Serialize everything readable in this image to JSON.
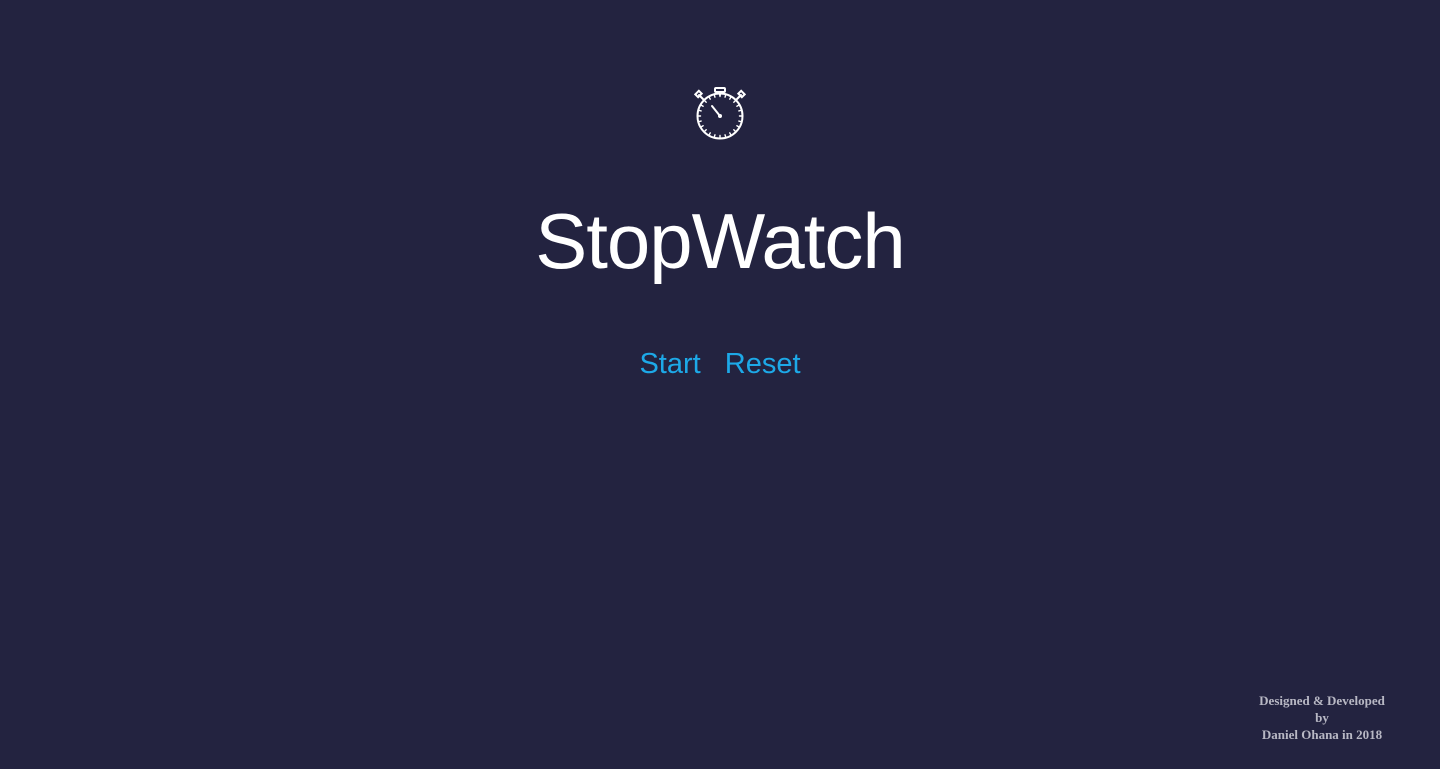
{
  "app": {
    "icon": "stopwatch-icon",
    "title": "StopWatch"
  },
  "controls": {
    "start_label": "Start",
    "reset_label": "Reset"
  },
  "footer": {
    "line1": "Designed & Developed",
    "line2": "by",
    "line3": "Daniel Ohana in 2018"
  },
  "colors": {
    "background": "#232340",
    "accent": "#1da9e8",
    "title": "#ffffff",
    "footer_text": "#b8b8c4"
  }
}
